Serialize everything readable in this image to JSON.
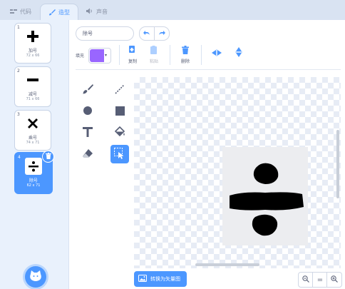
{
  "tabs": [
    {
      "label": "代码",
      "icon": "code-icon"
    },
    {
      "label": "造型",
      "icon": "brush-icon"
    },
    {
      "label": "声音",
      "icon": "speaker-icon"
    }
  ],
  "costumes": [
    {
      "number": "1",
      "name": "加号",
      "size": "72 x 66",
      "icon": "plus-icon"
    },
    {
      "number": "2",
      "name": "减号",
      "size": "71 x 66",
      "icon": "minus-icon"
    },
    {
      "number": "3",
      "name": "乘号",
      "size": "74 x 71",
      "icon": "multiply-icon"
    },
    {
      "number": "4",
      "name": "除号",
      "size": "62 x 71",
      "icon": "divide-icon",
      "selected": true
    }
  ],
  "editor": {
    "costume_name": "除号",
    "fill_label": "填充",
    "fill_color": "#9966ff",
    "copy_label": "复制",
    "paste_label": "粘贴",
    "delete_label": "删除",
    "convert_label": "转换为矢量图"
  },
  "colors": {
    "accent": "#4c97ff",
    "delete_red": "#4c97ff"
  }
}
